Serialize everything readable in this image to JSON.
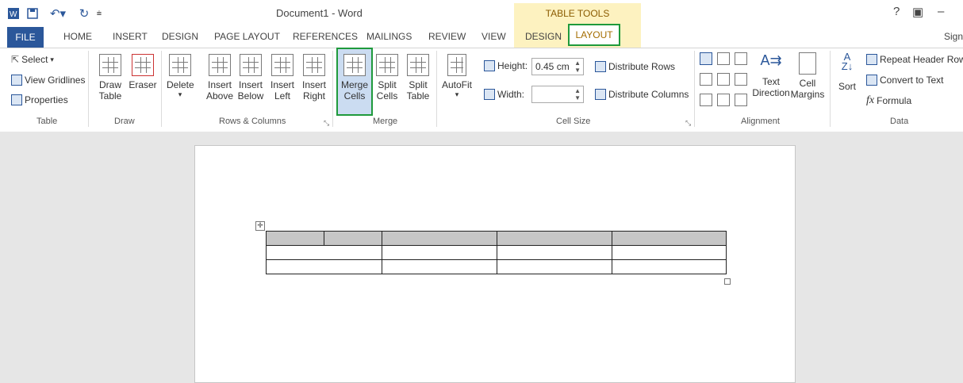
{
  "window": {
    "title": "Document1 - Word",
    "contextual_group": "TABLE TOOLS",
    "help": "?",
    "restore": "▣",
    "minimize": "–",
    "signin": "Sign"
  },
  "tabs": {
    "file": "FILE",
    "home": "HOME",
    "insert": "INSERT",
    "design": "DESIGN",
    "page_layout": "PAGE LAYOUT",
    "references": "REFERENCES",
    "mailings": "MAILINGS",
    "review": "REVIEW",
    "view": "VIEW",
    "tt_design": "DESIGN",
    "tt_layout": "LAYOUT"
  },
  "groups": {
    "table": {
      "label": "Table",
      "select": "Select",
      "view_gridlines": "View Gridlines",
      "properties": "Properties"
    },
    "draw": {
      "label": "Draw",
      "draw_table_1": "Draw",
      "draw_table_2": "Table",
      "eraser": "Eraser"
    },
    "rows_cols": {
      "label": "Rows & Columns",
      "delete": "Delete",
      "insert_above_1": "Insert",
      "insert_above_2": "Above",
      "insert_below_1": "Insert",
      "insert_below_2": "Below",
      "insert_left_1": "Insert",
      "insert_left_2": "Left",
      "insert_right_1": "Insert",
      "insert_right_2": "Right"
    },
    "merge": {
      "label": "Merge",
      "merge_1": "Merge",
      "merge_2": "Cells",
      "split_cells_1": "Split",
      "split_cells_2": "Cells",
      "split_table_1": "Split",
      "split_table_2": "Table"
    },
    "cell_size": {
      "label": "Cell Size",
      "autofit": "AutoFit",
      "height_label": "Height:",
      "height_value": "0.45 cm",
      "width_label": "Width:",
      "width_value": "",
      "distribute_rows": "Distribute Rows",
      "distribute_columns": "Distribute Columns"
    },
    "alignment": {
      "label": "Alignment",
      "text_direction_1": "Text",
      "text_direction_2": "Direction",
      "cell_margins_1": "Cell",
      "cell_margins_2": "Margins"
    },
    "data": {
      "label": "Data",
      "sort": "Sort",
      "repeat_header_rows": "Repeat Header Rows",
      "convert_to_text": "Convert to Text",
      "formula": "Formula"
    }
  }
}
